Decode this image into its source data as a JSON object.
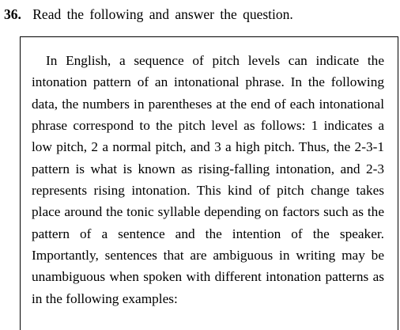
{
  "question": {
    "number": "36.",
    "prompt": "Read the following and answer the question."
  },
  "passage": {
    "text": "In English, a sequence of pitch levels can indicate the intonation pattern of an intonational phrase. In the following data, the numbers in parentheses at the end of each intonational phrase correspond to the pitch level as follows: 1 indicates a low pitch, 2 a normal pitch, and 3 a high pitch. Thus, the 2-3-1 pattern is what is known as rising-falling intonation, and 2-3 represents rising intonation. This kind of pitch change takes place around the tonic syllable depending on factors such as the pattern of a sentence and the intention of the speaker. Importantly, sentences that are ambiguous in writing may be unambiguous when spoken with different intonation patterns as in the following examples:"
  }
}
